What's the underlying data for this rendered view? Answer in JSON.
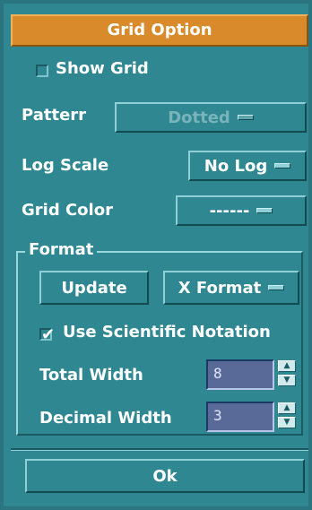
{
  "window": {
    "title": "Grid Option"
  },
  "show_grid": {
    "label": "Show Grid",
    "checked": false
  },
  "pattern": {
    "label": "Patterr",
    "value": "Dotted",
    "enabled": false
  },
  "log_scale": {
    "label": "Log Scale",
    "value": "No Log"
  },
  "grid_color": {
    "label": "Grid Color",
    "value": "------"
  },
  "format": {
    "group_label": "Format",
    "update_label": "Update",
    "axis_value": "X Format",
    "scientific": {
      "label": "Use Scientific Notation",
      "checked": true
    },
    "total_width": {
      "label": "Total Width",
      "value": "8"
    },
    "decimal_width": {
      "label": "Decimal Width",
      "value": "3"
    }
  },
  "ok_label": "Ok",
  "spin_up": "▲",
  "spin_down": "▼",
  "check_mark": "✔"
}
